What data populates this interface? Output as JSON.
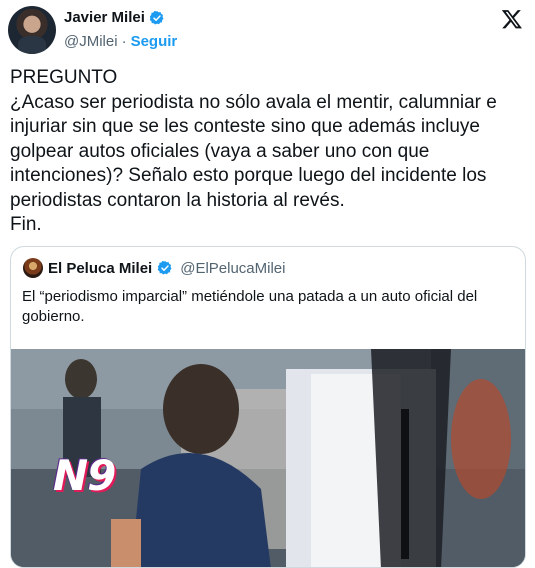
{
  "author": {
    "name": "Javier Milei",
    "handle": "@JMilei",
    "separator": "·",
    "follow_label": "Seguir"
  },
  "tweet": {
    "text": "PREGUNTO\n¿Acaso ser periodista no sólo avala el mentir, calumniar e injuriar sin que se les conteste sino que además incluye golpear autos oficiales (vaya a saber uno con que intenciones)? Señalo esto porque luego del incidente los periodistas contaron la historia al revés.\nFin."
  },
  "quoted": {
    "name": "El Peluca Milei",
    "handle": "@ElPelucaMilei",
    "text": "El “periodismo imparcial” metiéndole una patada a un auto oficial del gobierno.",
    "media_logo": "N9"
  },
  "icons": {
    "verified": "verified-badge-icon",
    "x_logo": "x-logo-icon"
  },
  "colors": {
    "accent": "#1d9bf0",
    "text": "#0f1419",
    "secondary": "#536471",
    "border": "#cfd9de"
  }
}
